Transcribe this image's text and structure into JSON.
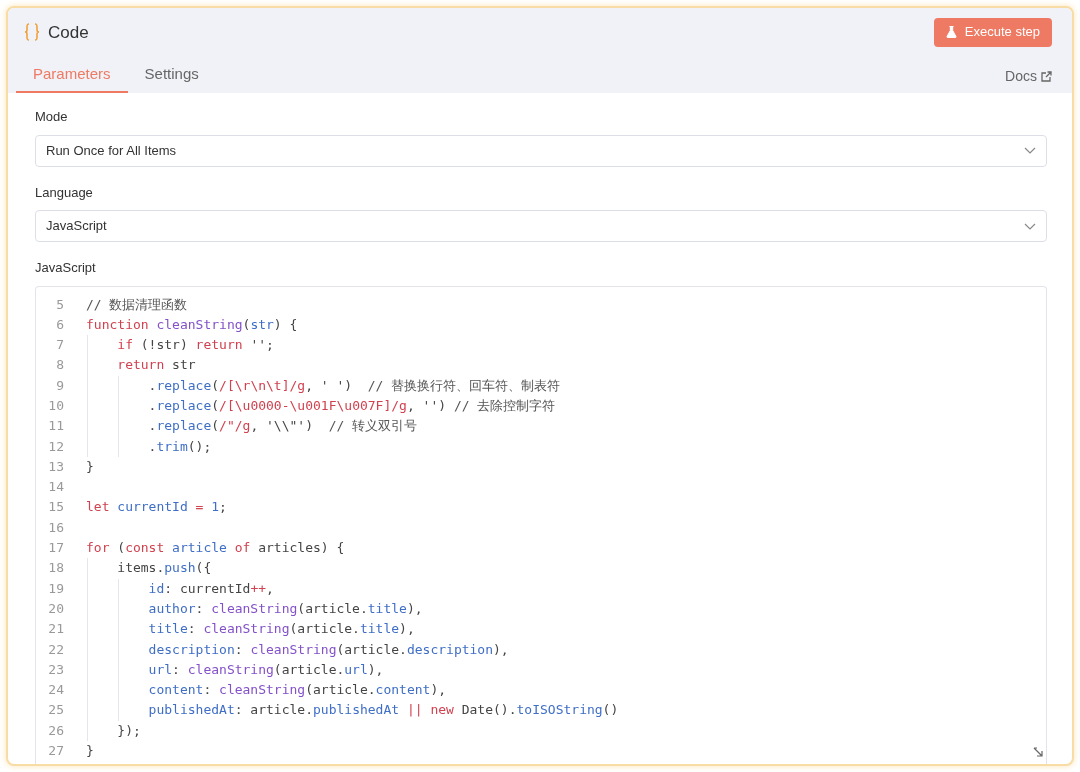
{
  "header": {
    "title": "Code",
    "action": "Execute step"
  },
  "tabs": [
    {
      "label": "Parameters",
      "selected": true
    },
    {
      "label": "Settings",
      "selected": false
    }
  ],
  "docs_link": "Docs",
  "fields": [
    {
      "label": "Mode",
      "value": "Run Once for All Items"
    },
    {
      "label": "Language",
      "value": "JavaScript"
    }
  ],
  "editor": {
    "label": "JavaScript",
    "lines": [
      {
        "number": "5",
        "tokens": [
          {
            "kind": "comment",
            "text": "// 数据清理函数"
          }
        ]
      },
      {
        "number": "6",
        "tokens": [
          {
            "kind": "kw",
            "text": "function "
          },
          {
            "kind": "fn",
            "text": "cleanString"
          },
          {
            "kind": "plain",
            "text": "("
          },
          {
            "kind": "prop",
            "text": "str"
          },
          {
            "kind": "plain",
            "text": ") {"
          }
        ]
      },
      {
        "number": "7",
        "tokens": [
          {
            "kind": "kw",
            "text": "    if"
          },
          {
            "kind": "plain",
            "text": " (!str) "
          },
          {
            "kind": "kw",
            "text": "return"
          },
          {
            "kind": "plain",
            "text": " '';"
          }
        ]
      },
      {
        "number": "8",
        "tokens": [
          {
            "kind": "kw",
            "text": "    return"
          },
          {
            "kind": "plain",
            "text": " str"
          }
        ]
      },
      {
        "number": "9",
        "tokens": [
          {
            "kind": "plain",
            "text": "        ."
          },
          {
            "kind": "prop",
            "text": "replace"
          },
          {
            "kind": "plain",
            "text": "("
          },
          {
            "kind": "kw",
            "text": "/[\\r\\n\\t]/g"
          },
          {
            "kind": "plain",
            "text": ", ' ')  "
          },
          {
            "kind": "comment",
            "text": "// 替换换行符、回车符、制表符"
          }
        ]
      },
      {
        "number": "10",
        "tokens": [
          {
            "kind": "plain",
            "text": "        ."
          },
          {
            "kind": "prop",
            "text": "replace"
          },
          {
            "kind": "plain",
            "text": "("
          },
          {
            "kind": "kw",
            "text": "/[\\u0000-\\u001F\\u007F]/g"
          },
          {
            "kind": "plain",
            "text": ", '') "
          },
          {
            "kind": "comment",
            "text": "// 去除控制字符"
          }
        ]
      },
      {
        "number": "11",
        "tokens": [
          {
            "kind": "plain",
            "text": "        ."
          },
          {
            "kind": "prop",
            "text": "replace"
          },
          {
            "kind": "plain",
            "text": "("
          },
          {
            "kind": "kw",
            "text": "/\"/g"
          },
          {
            "kind": "plain",
            "text": ", '\\\\\"')  "
          },
          {
            "kind": "comment",
            "text": "// 转义双引号"
          }
        ]
      },
      {
        "number": "12",
        "tokens": [
          {
            "kind": "plain",
            "text": "        ."
          },
          {
            "kind": "prop",
            "text": "trim"
          },
          {
            "kind": "plain",
            "text": "();"
          }
        ]
      },
      {
        "number": "13",
        "tokens": [
          {
            "kind": "plain",
            "text": "}"
          }
        ]
      },
      {
        "number": "14"
      },
      {
        "number": "15",
        "tokens": [
          {
            "kind": "kw",
            "text": "let "
          },
          {
            "kind": "prop",
            "text": "currentId "
          },
          {
            "kind": "kw",
            "text": "= "
          },
          {
            "kind": "prop",
            "text": "1"
          },
          {
            "kind": "plain",
            "text": ";"
          }
        ]
      },
      {
        "number": "16"
      },
      {
        "number": "17",
        "tokens": [
          {
            "kind": "kw",
            "text": "for"
          },
          {
            "kind": "plain",
            "text": " ("
          },
          {
            "kind": "kw",
            "text": "const "
          },
          {
            "kind": "prop",
            "text": "article "
          },
          {
            "kind": "kw",
            "text": "of"
          },
          {
            "kind": "plain",
            "text": " articles) {"
          }
        ]
      },
      {
        "number": "18",
        "tokens": [
          {
            "kind": "plain",
            "text": "    items."
          },
          {
            "kind": "prop",
            "text": "push"
          },
          {
            "kind": "plain",
            "text": "({"
          }
        ]
      },
      {
        "number": "19",
        "tokens": [
          {
            "kind": "prop",
            "text": "        id"
          },
          {
            "kind": "plain",
            "text": ": currentId"
          },
          {
            "kind": "kw",
            "text": "++"
          },
          {
            "kind": "plain",
            "text": ","
          }
        ]
      },
      {
        "number": "20",
        "tokens": [
          {
            "kind": "prop",
            "text": "        author"
          },
          {
            "kind": "plain",
            "text": ": "
          },
          {
            "kind": "fn",
            "text": "cleanString"
          },
          {
            "kind": "plain",
            "text": "(article."
          },
          {
            "kind": "prop",
            "text": "title"
          },
          {
            "kind": "plain",
            "text": "),"
          }
        ]
      },
      {
        "number": "21",
        "tokens": [
          {
            "kind": "prop",
            "text": "        title"
          },
          {
            "kind": "plain",
            "text": ": "
          },
          {
            "kind": "fn",
            "text": "cleanString"
          },
          {
            "kind": "plain",
            "text": "(article."
          },
          {
            "kind": "prop",
            "text": "title"
          },
          {
            "kind": "plain",
            "text": "),"
          }
        ]
      },
      {
        "number": "22",
        "tokens": [
          {
            "kind": "prop",
            "text": "        description"
          },
          {
            "kind": "plain",
            "text": ": "
          },
          {
            "kind": "fn",
            "text": "cleanString"
          },
          {
            "kind": "plain",
            "text": "(article."
          },
          {
            "kind": "prop",
            "text": "description"
          },
          {
            "kind": "plain",
            "text": "),"
          }
        ]
      },
      {
        "number": "23",
        "tokens": [
          {
            "kind": "prop",
            "text": "        url"
          },
          {
            "kind": "plain",
            "text": ": "
          },
          {
            "kind": "fn",
            "text": "cleanString"
          },
          {
            "kind": "plain",
            "text": "(article."
          },
          {
            "kind": "prop",
            "text": "url"
          },
          {
            "kind": "plain",
            "text": "),"
          }
        ]
      },
      {
        "number": "24",
        "tokens": [
          {
            "kind": "prop",
            "text": "        content"
          },
          {
            "kind": "plain",
            "text": ": "
          },
          {
            "kind": "fn",
            "text": "cleanString"
          },
          {
            "kind": "plain",
            "text": "(article."
          },
          {
            "kind": "prop",
            "text": "content"
          },
          {
            "kind": "plain",
            "text": "),"
          }
        ]
      },
      {
        "number": "25",
        "tokens": [
          {
            "kind": "prop",
            "text": "        publishedAt"
          },
          {
            "kind": "plain",
            "text": ": article."
          },
          {
            "kind": "prop",
            "text": "publishedAt "
          },
          {
            "kind": "kw",
            "text": "|| new"
          },
          {
            "kind": "plain",
            "text": " Date()."
          },
          {
            "kind": "prop",
            "text": "toISOString"
          },
          {
            "kind": "plain",
            "text": "()"
          }
        ]
      },
      {
        "number": "26",
        "tokens": [
          {
            "kind": "plain",
            "text": "    });"
          }
        ]
      },
      {
        "number": "27",
        "tokens": [
          {
            "kind": "plain",
            "text": "}"
          }
        ]
      }
    ]
  }
}
